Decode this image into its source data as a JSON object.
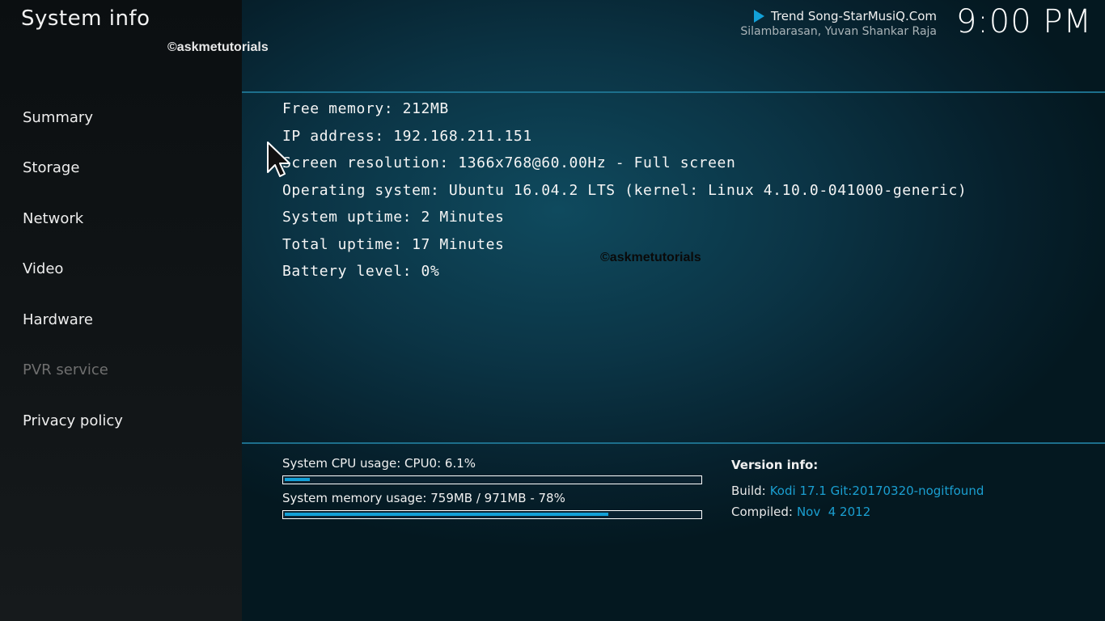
{
  "header": {
    "title": "System info",
    "watermark": "©askmetutorials",
    "now_playing": {
      "title": "Trend Song-StarMusiQ.Com",
      "artist": "Silambarasan, Yuvan Shankar Raja"
    },
    "clock": "9:00 PM"
  },
  "sidebar": {
    "items": [
      {
        "label": "Summary",
        "enabled": true
      },
      {
        "label": "Storage",
        "enabled": true
      },
      {
        "label": "Network",
        "enabled": true
      },
      {
        "label": "Video",
        "enabled": true
      },
      {
        "label": "Hardware",
        "enabled": true
      },
      {
        "label": "PVR service",
        "enabled": false
      },
      {
        "label": "Privacy policy",
        "enabled": true
      }
    ]
  },
  "main": {
    "lines": [
      "Free memory: 212MB",
      "IP address: 192.168.211.151",
      "Screen resolution: 1366x768@60.00Hz - Full screen",
      "Operating system: Ubuntu 16.04.2 LTS (kernel: Linux 4.10.0-041000-generic)",
      "System uptime: 2 Minutes",
      "Total uptime: 17 Minutes",
      "Battery level: 0%"
    ],
    "watermark": "©askmetutorials"
  },
  "usage": {
    "cpu": {
      "label": "System CPU usage: CPU0: 6.1%",
      "percent": 6.1
    },
    "memory": {
      "label": "System memory usage: 759MB / 971MB - 78%",
      "percent": 78
    }
  },
  "version": {
    "header": "Version info:",
    "build_label": "Build:",
    "build_value": "Kodi 17.1 Git:20170320-nogitfound",
    "compiled_label": "Compiled:",
    "compiled_value": "Nov  4 2012"
  },
  "colors": {
    "accent": "#12a0d7",
    "disabled": "#6f6f6f"
  }
}
